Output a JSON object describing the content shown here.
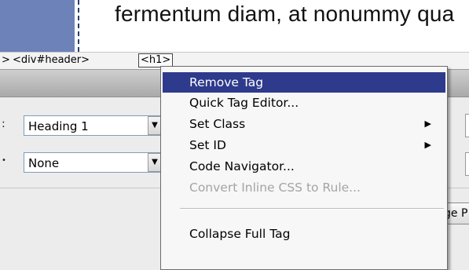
{
  "design_view": {
    "body_text": "fermentum diam, at nonummy qua"
  },
  "tag_selector": {
    "arrow": ">",
    "parent_tag": "<div#header>",
    "selected_tag": "<h1>"
  },
  "properties": {
    "format_label": ":",
    "format_value": "Heading 1",
    "id_label": "•",
    "id_value": "None",
    "page_button_label": "ge P"
  },
  "context_menu": {
    "items": [
      {
        "label": "Remove Tag",
        "highlighted": true
      },
      {
        "label": "Quick Tag Editor..."
      },
      {
        "label": "Set Class",
        "submenu": true
      },
      {
        "label": "Set ID",
        "submenu": true
      },
      {
        "label": "Code Navigator..."
      },
      {
        "label": "Convert Inline CSS to Rule...",
        "disabled": true
      },
      {
        "label": "Collapse Full Tag"
      }
    ],
    "submenu_arrow": "▶"
  },
  "colors": {
    "highlight": "#2e3a8c",
    "design_block": "#6d82b8"
  }
}
